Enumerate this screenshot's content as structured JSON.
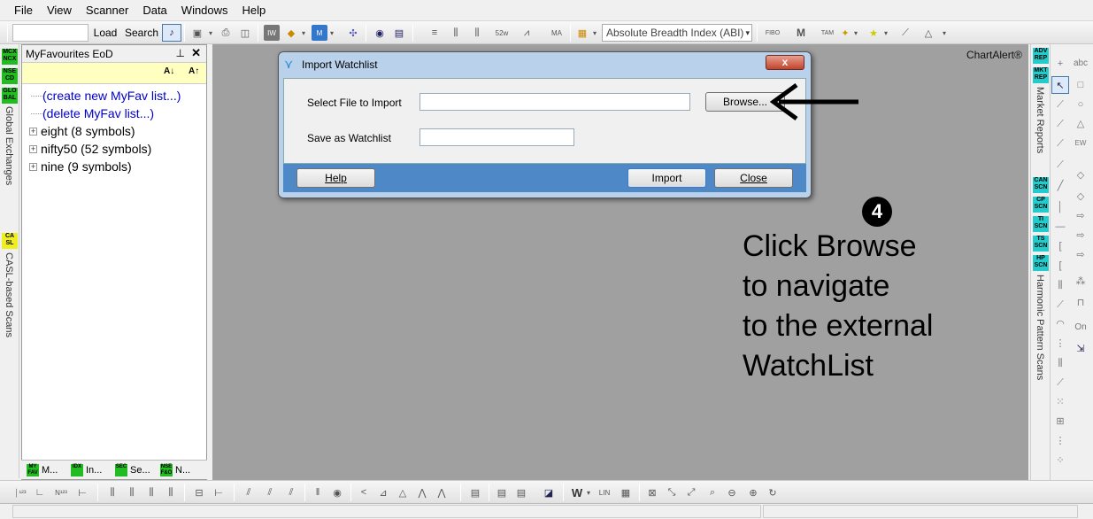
{
  "menu": [
    "File",
    "View",
    "Scanner",
    "Data",
    "Windows",
    "Help"
  ],
  "toolbar": {
    "load_label": "Load",
    "search_label": "Search",
    "breadth_select": "Absolute Breadth Index (ABI)"
  },
  "left_strip": {
    "badges": [
      {
        "text": "MCX NCX",
        "bg": "#22bb22"
      },
      {
        "text": "NSE CD",
        "bg": "#22bb22"
      },
      {
        "text": "GLO BAL",
        "bg": "#22bb22"
      }
    ],
    "global_exchanges": "Global Exchanges",
    "casl_badge": "CA SL",
    "casl_label": "CASL-based Scans"
  },
  "panel": {
    "title": "MyFavourites EoD",
    "items": [
      {
        "label": "(create new MyFav list...)",
        "link": true
      },
      {
        "label": "(delete MyFav list...)",
        "link": true
      },
      {
        "label": "eight (8 symbols)",
        "link": false
      },
      {
        "label": "nifty50 (52 symbols)",
        "link": false
      },
      {
        "label": "nine (9 symbols)",
        "link": false
      }
    ],
    "tabs": [
      {
        "badge": "MY FAV",
        "label": "M..."
      },
      {
        "badge": "IDX",
        "label": "In..."
      },
      {
        "badge": "SEC",
        "label": "Se..."
      },
      {
        "badge": "NSE F&O",
        "label": "N..."
      }
    ]
  },
  "chart_alert": "ChartAlert®",
  "dialog": {
    "title": "Import Watchlist",
    "close": "x",
    "file_label": "Select File to Import",
    "file_value": "",
    "watchlist_label": "Save as Watchlist",
    "watchlist_value": "",
    "browse": "Browse...",
    "help": "Help",
    "import": "Import",
    "close_btn": "Close"
  },
  "right_strip": {
    "badges1": [
      {
        "text": "ADV REP",
        "bg": "#22cccc"
      },
      {
        "text": "MKT REP",
        "bg": "#22cccc"
      }
    ],
    "market_reports": "Market Reports",
    "badges2": [
      {
        "text": "CAN SCN",
        "bg": "#22cccc"
      },
      {
        "text": "CP SCN",
        "bg": "#22cccc"
      },
      {
        "text": "TI SCN",
        "bg": "#22cccc"
      },
      {
        "text": "TS SCN",
        "bg": "#22cccc"
      },
      {
        "text": "HP SCN",
        "bg": "#22cccc"
      }
    ],
    "harmonic": "Harmonic Pattern Scans",
    "tools": [
      "abc",
      "On"
    ]
  },
  "annotation": {
    "number": "4",
    "text": "Click Browse\nto navigate\nto the external\nWatchList"
  },
  "colors": {
    "accent": "#4f88c6",
    "workspace": "#a0a0a0",
    "link": "#0000cc"
  }
}
